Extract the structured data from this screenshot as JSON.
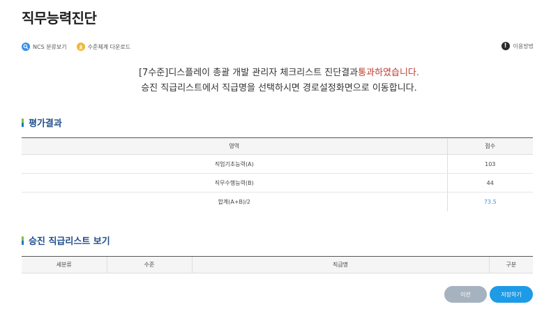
{
  "page": {
    "title": "직무능력진단"
  },
  "toolbar": {
    "ncs_label": "NCS 분류보기",
    "download_label": "수준체계 다운로드",
    "help_label": "이용방법"
  },
  "result": {
    "line1_prefix": "[7수준]디스플레이 총괄 개발 관리자 체크리스트 진단결과",
    "line1_status": "통과하였습니다.",
    "line2": "승진 직급리스트에서 직급명을 선택하시면 경로설정화면으로 이동합니다."
  },
  "evaluation": {
    "heading": "평가결과",
    "headers": {
      "area": "영역",
      "score": "점수"
    },
    "rows": [
      {
        "area": "직업기초능력(A)",
        "score": "103"
      },
      {
        "area": "직무수행능력(B)",
        "score": "44"
      },
      {
        "area": "합계(A+B)/2",
        "score": "73.5"
      }
    ]
  },
  "promotion": {
    "heading": "승진 직급리스트 보기",
    "headers": {
      "subcategory": "세분류",
      "level": "수준",
      "position": "직급명",
      "type": "구분"
    }
  },
  "buttons": {
    "prev": "이전",
    "save": "저장하기"
  },
  "colors": {
    "accent": "#1e9be6",
    "pass": "#c0392b",
    "heading": "#1f4e8c"
  }
}
